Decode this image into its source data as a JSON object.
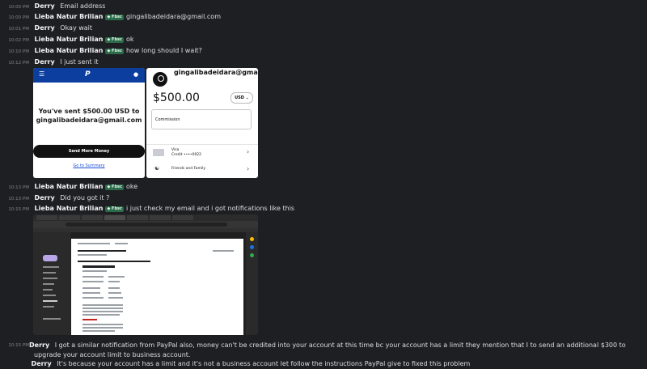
{
  "messages": [
    {
      "time": "10:00 PM",
      "author": "Derry",
      "text": "Email address"
    },
    {
      "time": "10:00 PM",
      "author": "Lieba Natur Brilian",
      "badge": "◆ Fbsc",
      "text": "gingalibadeidara@gmail.com"
    },
    {
      "time": "10:01 PM",
      "author": "Derry",
      "text": "Okay wait"
    },
    {
      "time": "10:02 PM",
      "author": "Lieba Natur Brilian",
      "badge": "◆ Fbsc",
      "text": "ok"
    },
    {
      "time": "10:10 PM",
      "author": "Lieba Natur Brilian",
      "badge": "◆ Fbsc",
      "text": "how long should I wait?"
    },
    {
      "time": "10:12 PM",
      "author": "Derry",
      "text": "I just sent it"
    },
    {
      "time": "10:13 PM",
      "author": "Lieba Natur Brilian",
      "badge": "◆ Fbsc",
      "text": "oke"
    },
    {
      "time": "10:13 PM",
      "author": "Derry",
      "text": "Did you got it ?"
    },
    {
      "time": "10:15 PM",
      "author": "Lieba Natur Brilian",
      "badge": "◆ Fbsc",
      "text": "i just check my email and i got notifications like this"
    },
    {
      "time": "10:15 PM",
      "author": "Derry",
      "text": "I got a similar notification from PayPal also, money can't be credited into your account at this time bc your account has a limit they mention that I to send an additional $300 to upgrade your account limit to business account."
    },
    {
      "time": "",
      "author": "Derry",
      "text": "It's because your account has a limit and it's not a business account let follow the instructions PayPal give to fixed this problem"
    }
  ],
  "paypal_sent": {
    "menu_icon": "menu-icon",
    "logo": "P",
    "bell_icon": "bell-icon",
    "message": "You've sent $500.00 USD to gingalibadeidara@gmail.com",
    "send_more": "Send More Money",
    "go_summary": "Go to Summary"
  },
  "paypal_pay": {
    "recipient": "gingalibadeidara@gmail.com",
    "amount": "$500.00",
    "currency": "USD ⌄",
    "commission": "Commission",
    "card_name": "Visa",
    "card_number": "Credit ••••0022",
    "friends": "Friends and Family",
    "chevron": "›"
  },
  "colors": {
    "background": "#1e1f22",
    "paypal_blue": "#0b3e9e",
    "badge_green": "#2b6b4a"
  }
}
